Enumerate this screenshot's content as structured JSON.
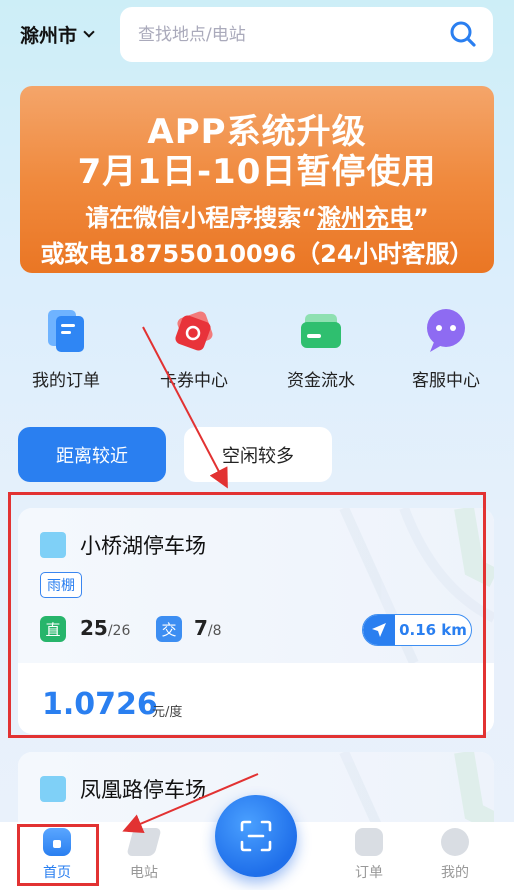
{
  "header": {
    "city": "滁州市",
    "search_placeholder": "查找地点/电站"
  },
  "banner": {
    "line1": "APP系统升级",
    "line2": "7月1日-10日暂停使用",
    "line3_prefix": "请在微信小程序搜索“",
    "line3_link": "滁州充电",
    "line3_suffix": "”",
    "line4": "或致电18755010096（24小时客服）"
  },
  "quick_menu": [
    {
      "label": "我的订单",
      "icon": "order-doc-icon"
    },
    {
      "label": "卡券中心",
      "icon": "coupon-ticket-icon"
    },
    {
      "label": "资金流水",
      "icon": "wallet-card-icon"
    },
    {
      "label": "客服中心",
      "icon": "chat-bubble-icon"
    }
  ],
  "tabs": {
    "active": "距离较近",
    "inactive": "空闲较多"
  },
  "stations": [
    {
      "name": "小桥湖停车场",
      "tag": "雨棚",
      "fast_label": "直",
      "fast_free": "25",
      "fast_total": "/26",
      "slow_label": "交",
      "slow_free": "7",
      "slow_total": "/8",
      "distance": "0.16 km",
      "price": "1.0726",
      "unit": "元/度"
    },
    {
      "name": "凤凰路停车场"
    }
  ],
  "nav": {
    "home": "首页",
    "stations": "电站",
    "orders": "订单",
    "mine": "我的"
  },
  "colors": {
    "accent": "#2a7ff0",
    "banner": "#f08a3e",
    "highlight": "#e23232"
  }
}
